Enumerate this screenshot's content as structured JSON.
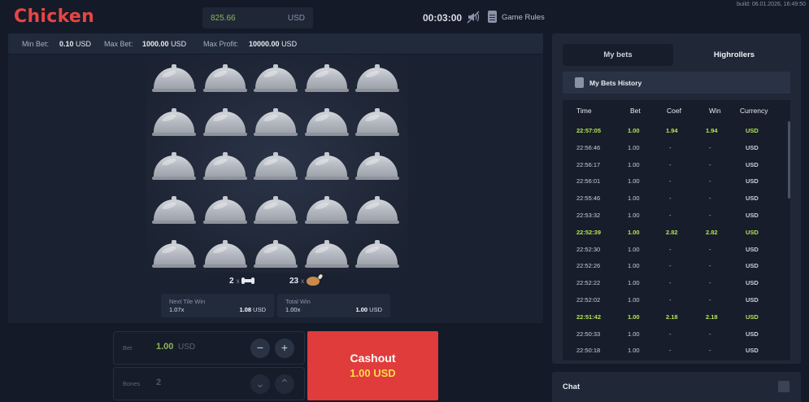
{
  "header": {
    "logo": "Chicken",
    "balance": "825.66",
    "balance_currency": "USD",
    "timer": "00:03:00",
    "rules_label": "Game Rules",
    "build": "build: 06.01.2026, 16:49:50"
  },
  "limits": {
    "min_label": "Min Bet:",
    "min_value": "0.10",
    "min_unit": "USD",
    "max_label": "Max Bet:",
    "max_value": "1000.00",
    "max_unit": "USD",
    "profit_label": "Max Profit:",
    "profit_value": "10000.00",
    "profit_unit": "USD"
  },
  "board": {
    "rows": 5,
    "cols": 5,
    "bones_count": "2",
    "bones_x": "x",
    "chicken_count": "23",
    "chicken_x": "x",
    "next_tile": {
      "title": "Next Tile Win",
      "multiplier": "1.07x",
      "amount": "1.08",
      "currency": "USD"
    },
    "total_win": {
      "title": "Total Win",
      "multiplier": "1.00x",
      "amount": "1.00",
      "currency": "USD"
    }
  },
  "controls": {
    "bet_label": "Bet",
    "bet_value": "1.00",
    "bet_unit": "USD",
    "minus": "−",
    "plus": "+",
    "bones_label": "Bones",
    "bones_value": "2",
    "down": "⌄",
    "up": "⌃",
    "cashout_label": "Cashout",
    "cashout_amount": "1.00",
    "cashout_currency": "USD"
  },
  "panel": {
    "tab_my": "My bets",
    "tab_high": "Highrollers",
    "history_title": "My Bets History",
    "columns": [
      "Time",
      "Bet",
      "Coef",
      "Win",
      "Currency"
    ],
    "rows": [
      {
        "time": "22:57:05",
        "bet": "1.00",
        "coef": "1.94",
        "win": "1.94",
        "cur": "USD",
        "won": true
      },
      {
        "time": "22:56:46",
        "bet": "1.00",
        "coef": "-",
        "win": "-",
        "cur": "USD",
        "won": false
      },
      {
        "time": "22:56:17",
        "bet": "1.00",
        "coef": "-",
        "win": "-",
        "cur": "USD",
        "won": false
      },
      {
        "time": "22:56:01",
        "bet": "1.00",
        "coef": "-",
        "win": "-",
        "cur": "USD",
        "won": false
      },
      {
        "time": "22:55:46",
        "bet": "1.00",
        "coef": "-",
        "win": "-",
        "cur": "USD",
        "won": false
      },
      {
        "time": "22:53:32",
        "bet": "1.00",
        "coef": "-",
        "win": "-",
        "cur": "USD",
        "won": false
      },
      {
        "time": "22:52:39",
        "bet": "1.00",
        "coef": "2.82",
        "win": "2.82",
        "cur": "USD",
        "won": true
      },
      {
        "time": "22:52:30",
        "bet": "1.00",
        "coef": "-",
        "win": "-",
        "cur": "USD",
        "won": false
      },
      {
        "time": "22:52:26",
        "bet": "1.00",
        "coef": "-",
        "win": "-",
        "cur": "USD",
        "won": false
      },
      {
        "time": "22:52:22",
        "bet": "1.00",
        "coef": "-",
        "win": "-",
        "cur": "USD",
        "won": false
      },
      {
        "time": "22:52:02",
        "bet": "1.00",
        "coef": "-",
        "win": "-",
        "cur": "USD",
        "won": false
      },
      {
        "time": "22:51:42",
        "bet": "1.00",
        "coef": "2.18",
        "win": "2.18",
        "cur": "USD",
        "won": true
      },
      {
        "time": "22:50:33",
        "bet": "1.00",
        "coef": "-",
        "win": "-",
        "cur": "USD",
        "won": false
      },
      {
        "time": "22:50:18",
        "bet": "1.00",
        "coef": "-",
        "win": "-",
        "cur": "USD",
        "won": false
      }
    ],
    "chat_label": "Chat"
  }
}
